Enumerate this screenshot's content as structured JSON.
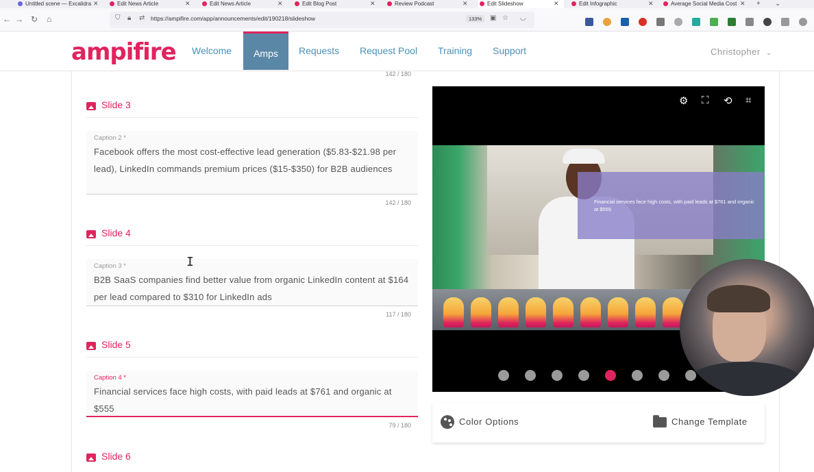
{
  "browser": {
    "tabs": [
      {
        "label": "Untitled scene — Excalidra",
        "active": false
      },
      {
        "label": "Edit News Article",
        "active": false
      },
      {
        "label": "Edit News Article",
        "active": false
      },
      {
        "label": "Edit Blog Post",
        "active": false
      },
      {
        "label": "Review Podcast",
        "active": false
      },
      {
        "label": "Edit Slideshow",
        "active": true
      },
      {
        "label": "Edit Infographic",
        "active": false
      },
      {
        "label": "Average Social Media Cost",
        "active": false
      }
    ],
    "new_tab": "+",
    "tab_list": "⌄",
    "url": "https://ampifire.com/app/announcements/edit/190218/slideshow",
    "zoom": "133%"
  },
  "app": {
    "logo": "ampifire",
    "nav": [
      {
        "label": "Welcome",
        "active": false
      },
      {
        "label": "Amps",
        "active": true
      },
      {
        "label": "Requests",
        "active": false
      },
      {
        "label": "Request Pool",
        "active": false
      },
      {
        "label": "Training",
        "active": false
      },
      {
        "label": "Support",
        "active": false
      }
    ],
    "user": "Christopher",
    "accent": "#e0245e"
  },
  "editor": {
    "top_counter": "142 / 180",
    "slides": [
      {
        "title": "Slide 3",
        "caption_label": "Caption 2 *",
        "caption": "Facebook offers the most cost-effective lead generation ($5.83-$21.98 per lead), LinkedIn commands premium prices ($15-$350) for B2B audiences",
        "counter": "142 / 180"
      },
      {
        "title": "Slide 4",
        "caption_label": "Caption 3 *",
        "caption": "B2B SaaS companies find better value from organic LinkedIn content at $164 per lead compared to $310 for LinkedIn ads",
        "counter": "117 / 180"
      },
      {
        "title": "Slide 5",
        "caption_label": "Caption 4 *",
        "caption": "Financial services face high costs, with paid leads at $761 and organic at $555",
        "counter": "79 / 180"
      }
    ],
    "next_slide_title": "Slide 6"
  },
  "preview": {
    "overlay_text": "Financial services face high costs, with paid leads at $761 and organic at $555",
    "dots_total": 8,
    "active_dot": 5,
    "color_options": "Color Options",
    "change_template": "Change Template"
  }
}
